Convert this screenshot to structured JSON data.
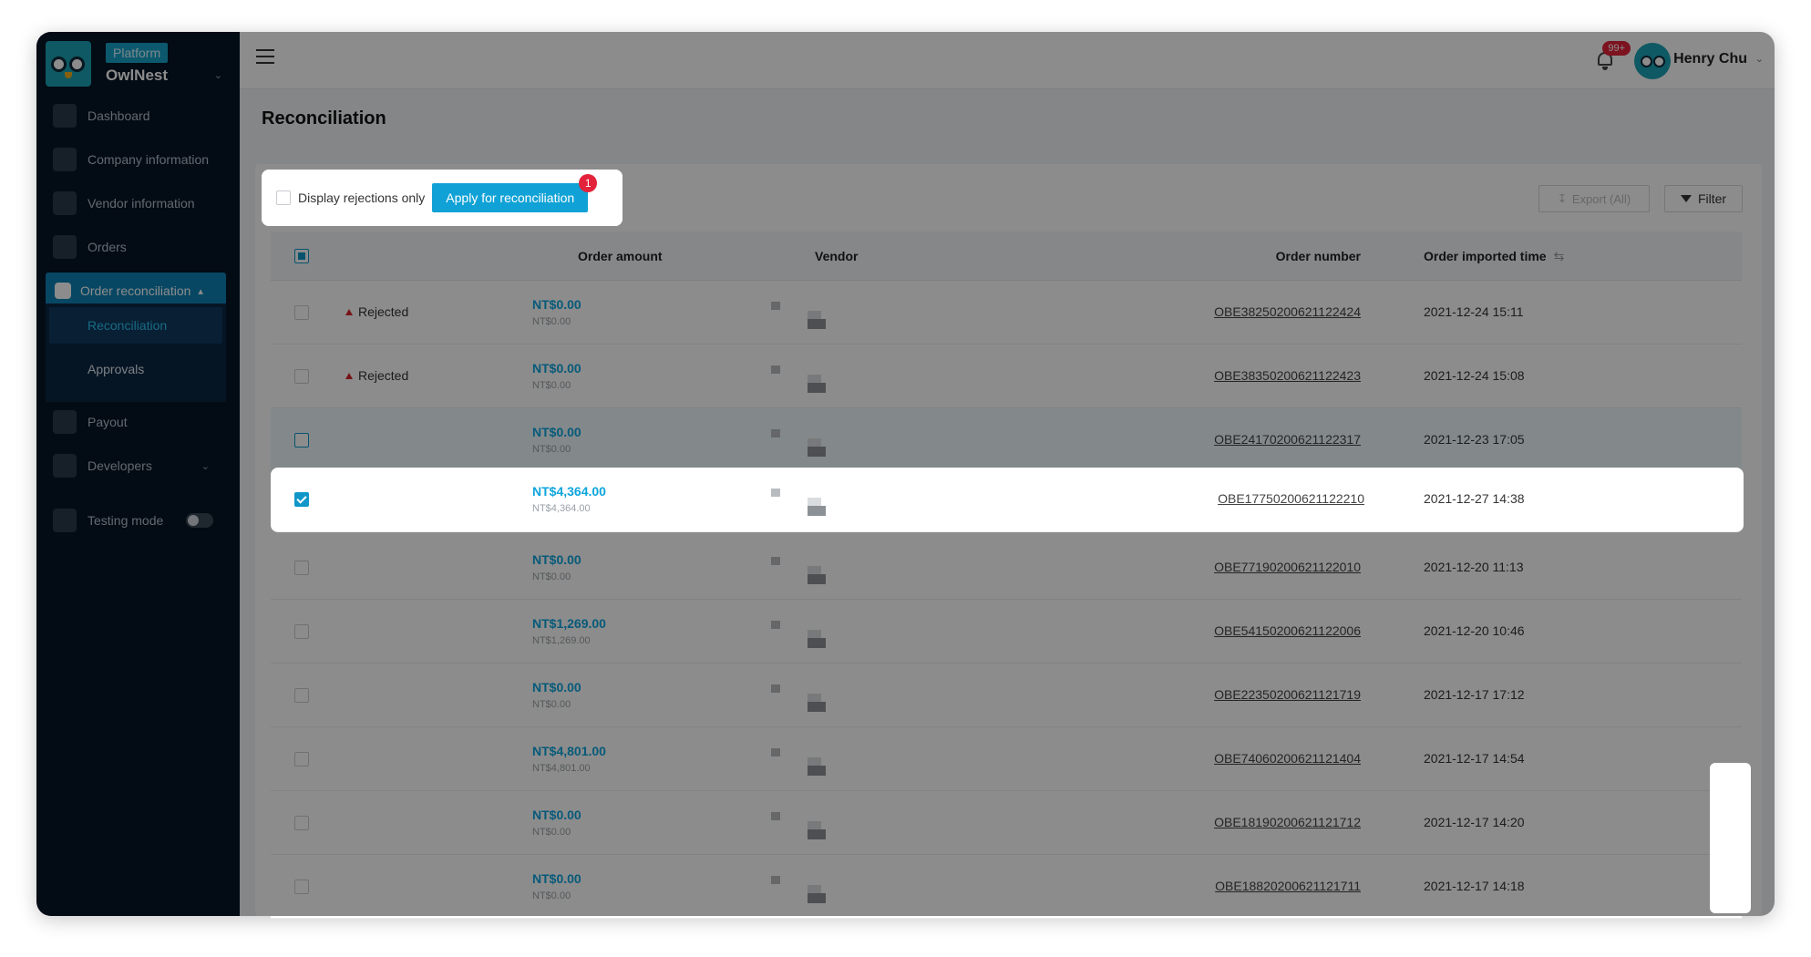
{
  "brand": {
    "tag": "Platform",
    "name": "OwlNest"
  },
  "sidebar": {
    "items": [
      {
        "label": "Dashboard"
      },
      {
        "label": "Company information"
      },
      {
        "label": "Vendor information"
      },
      {
        "label": "Orders"
      },
      {
        "label": "Order reconciliation"
      },
      {
        "label": "Payout"
      },
      {
        "label": "Developers"
      },
      {
        "label": "Testing mode"
      }
    ],
    "subitems": [
      {
        "label": "Reconciliation"
      },
      {
        "label": "Approvals"
      }
    ]
  },
  "header": {
    "notification_badge": "99+",
    "user_name": "Henry Chu"
  },
  "page": {
    "title": "Reconciliation"
  },
  "toolbar": {
    "rejections_label": "Display rejections only",
    "apply_label": "Apply for reconciliation",
    "apply_badge": "1",
    "export_label": "Export (All)",
    "filter_label": "Filter"
  },
  "table": {
    "columns": [
      "Order amount",
      "Vendor",
      "Order number",
      "Order imported time"
    ],
    "rows": [
      {
        "status": "Rejected",
        "amount": "NT$0.00",
        "amount_sub": "NT$0.00",
        "order_no": "OBE38250200621122424",
        "time": "2021-12-24 15:11"
      },
      {
        "status": "Rejected",
        "amount": "NT$0.00",
        "amount_sub": "NT$0.00",
        "order_no": "OBE38350200621122423",
        "time": "2021-12-24 15:08"
      },
      {
        "status": "",
        "amount": "NT$0.00",
        "amount_sub": "NT$0.00",
        "order_no": "OBE24170200621122317",
        "time": "2021-12-23 17:05"
      },
      {
        "status": "",
        "amount": "NT$4,364.00",
        "amount_sub": "NT$4,364.00",
        "order_no": "OBE17750200621122210",
        "time": "2021-12-27 14:38"
      },
      {
        "status": "",
        "amount": "NT$0.00",
        "amount_sub": "NT$0.00",
        "order_no": "OBE77190200621122010",
        "time": "2021-12-20 11:13"
      },
      {
        "status": "",
        "amount": "NT$1,269.00",
        "amount_sub": "NT$1,269.00",
        "order_no": "OBE54150200621122006",
        "time": "2021-12-20 10:46"
      },
      {
        "status": "",
        "amount": "NT$0.00",
        "amount_sub": "NT$0.00",
        "order_no": "OBE22350200621121719",
        "time": "2021-12-17 17:12"
      },
      {
        "status": "",
        "amount": "NT$4,801.00",
        "amount_sub": "NT$4,801.00",
        "order_no": "OBE74060200621121404",
        "time": "2021-12-17 14:54"
      },
      {
        "status": "",
        "amount": "NT$0.00",
        "amount_sub": "NT$0.00",
        "order_no": "OBE18190200621121712",
        "time": "2021-12-17 14:20"
      },
      {
        "status": "",
        "amount": "NT$0.00",
        "amount_sub": "NT$0.00",
        "order_no": "OBE18820200621121711",
        "time": "2021-12-17 14:18"
      }
    ]
  },
  "colors": {
    "accent": "#10a2d6",
    "sidebar_bg": "#071525",
    "active_nav": "#0f81b4",
    "alert": "#e2233a"
  }
}
